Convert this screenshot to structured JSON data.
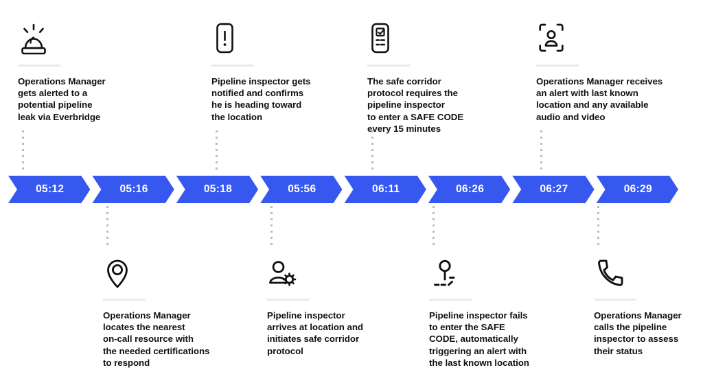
{
  "theme": {
    "accent_hex": "#3758EF",
    "text_hex": "#101114",
    "dot_hex": "#b9bcc4",
    "rule_hex": "#e9eaee"
  },
  "timeline": {
    "segments": [
      {
        "time": "05:12"
      },
      {
        "time": "05:16"
      },
      {
        "time": "05:18"
      },
      {
        "time": "05:56"
      },
      {
        "time": "06:11"
      },
      {
        "time": "06:26"
      },
      {
        "time": "06:27"
      },
      {
        "time": "06:29"
      }
    ]
  },
  "events_top": [
    {
      "time": "05:12",
      "icon": "siren-alarm-icon",
      "text": "Operations Manager\ngets alerted to a\npotential pipeline\nleak via Everbridge"
    },
    {
      "time": "05:18",
      "icon": "phone-alert-icon",
      "text": "Pipeline inspector gets\nnotified and confirms\nhe is heading toward\nthe location"
    },
    {
      "time": "06:11",
      "icon": "phone-checklist-icon",
      "text": "The safe corridor\nprotocol requires the\npipeline inspector\nto enter a SAFE CODE\nevery 15 minutes"
    },
    {
      "time": "06:27",
      "icon": "person-scan-icon",
      "text": "Operations Manager receives\nan alert with last known\nlocation and any available\naudio and video"
    }
  ],
  "events_bottom": [
    {
      "time": "05:16",
      "icon": "map-pin-icon",
      "text": "Operations Manager\nlocates the nearest\non-call resource with\nthe needed certifications\nto respond"
    },
    {
      "time": "05:56",
      "icon": "person-gear-icon",
      "text": "Pipeline inspector\narrives at location and\ninitiates safe corridor\nprotocol"
    },
    {
      "time": "06:26",
      "icon": "pin-signal-lost-icon",
      "text": "Pipeline inspector fails\nto enter the SAFE\nCODE, automatically\ntriggering an alert with\nthe last known location"
    },
    {
      "time": "06:29",
      "icon": "phone-call-icon",
      "text": "Operations Manager\ncalls the pipeline\ninspector to assess\ntheir status"
    }
  ]
}
